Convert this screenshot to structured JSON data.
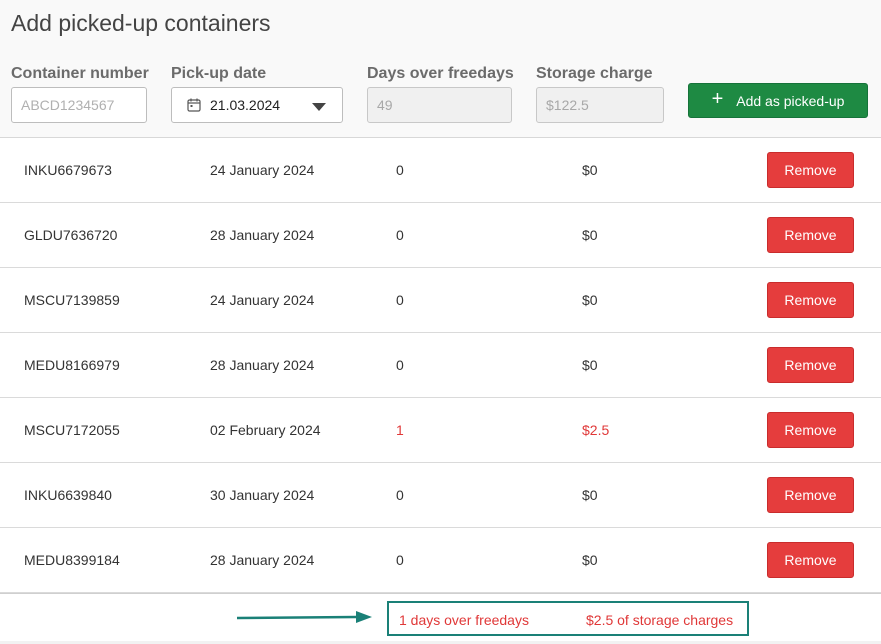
{
  "page": {
    "title": "Add picked-up containers"
  },
  "form": {
    "container_number": {
      "label": "Container number",
      "value": "",
      "placeholder": "ABCD1234567"
    },
    "pickup_date": {
      "label": "Pick-up date",
      "value": "21.03.2024"
    },
    "days_over": {
      "label": "Days over freedays",
      "value": "49"
    },
    "storage_charge": {
      "label": "Storage charge",
      "value": "$122.5"
    },
    "add_button": {
      "icon": "plus-icon",
      "label": "Add as picked-up"
    }
  },
  "table": {
    "remove_label": "Remove",
    "rows": [
      {
        "container": "INKU6679673",
        "date": "24 January 2024",
        "days": "0",
        "charge": "$0"
      },
      {
        "container": "GLDU7636720",
        "date": "28 January 2024",
        "days": "0",
        "charge": "$0"
      },
      {
        "container": "MSCU7139859",
        "date": "24 January 2024",
        "days": "0",
        "charge": "$0"
      },
      {
        "container": "MEDU8166979",
        "date": "28 January 2024",
        "days": "0",
        "charge": "$0"
      },
      {
        "container": "MSCU7172055",
        "date": "02 February 2024",
        "days": "1",
        "charge": "$2.5",
        "alert": true
      },
      {
        "container": "INKU6639840",
        "date": "30 January 2024",
        "days": "0",
        "charge": "$0"
      },
      {
        "container": "MEDU8399184",
        "date": "28 January 2024",
        "days": "0",
        "charge": "$0"
      }
    ]
  },
  "summary": {
    "days_text": "1 days over freedays",
    "charges_text": "$2.5 of storage charges"
  },
  "colors": {
    "accent_green": "#1e8a43",
    "danger_red": "#e53d3d",
    "alert_text": "#e03838",
    "annotation_teal": "#1a8077"
  }
}
